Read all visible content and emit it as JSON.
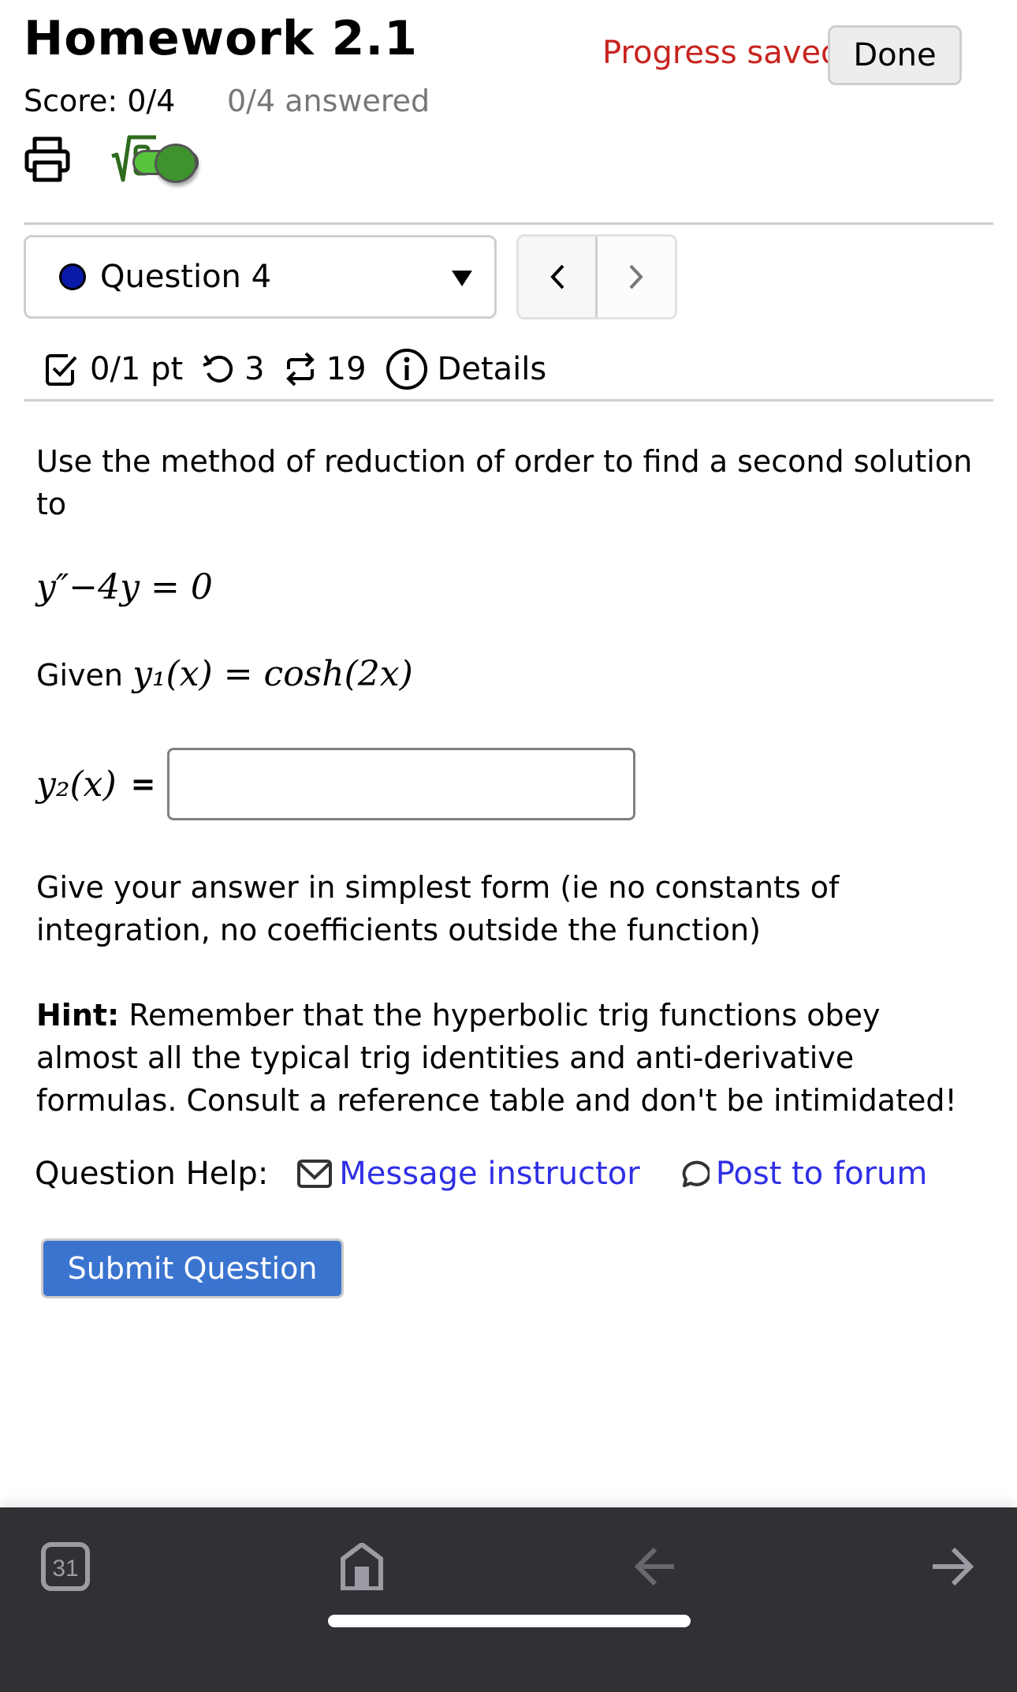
{
  "header": {
    "title": "Homework 2.1",
    "progress_status": "Progress saved",
    "done_label": "Done",
    "score": "Score: 0/4",
    "answered": "0/4 answered",
    "math_toggle_on": true
  },
  "question_nav": {
    "selected_question": "Question 4",
    "prev_label": "<",
    "next_label": ">"
  },
  "question_meta": {
    "points": "0/1 pt",
    "retries": "3",
    "attempts": "19",
    "details_label": "Details"
  },
  "question": {
    "prompt": "Use the method of reduction of order to find a second solution to",
    "equation": "y″−4y = 0",
    "given_label": "Given",
    "given_expression": "y₁(x) = cosh(2x)",
    "answer_label": "y₂(x)",
    "answer_equals": "=",
    "answer_value": "",
    "instructions": "Give your answer in simplest form (ie no constants of integration, no coefficients outside the function)",
    "hint_label": "Hint:",
    "hint_text": " Remember that the hyperbolic trig functions obey almost all the typical trig identities and anti-derivative formulas. Consult a reference table and don't be intimidated!"
  },
  "help": {
    "label": "Question Help:",
    "message_instructor": "Message instructor",
    "post_to_forum": "Post to forum"
  },
  "submit_label": "Submit Question",
  "bottom_bar": {
    "tabs_count": "31",
    "icons": [
      "tabs-icon",
      "home-icon",
      "back-arrow-icon",
      "forward-arrow-icon"
    ]
  },
  "colors": {
    "progress_saved": "#c8231f",
    "link": "#2f2fe6",
    "submit_bg": "#3b74cf",
    "toggle_on": "#57c43c",
    "question_dot": "#0a1aa8",
    "bottom_bar_bg": "#303135"
  }
}
